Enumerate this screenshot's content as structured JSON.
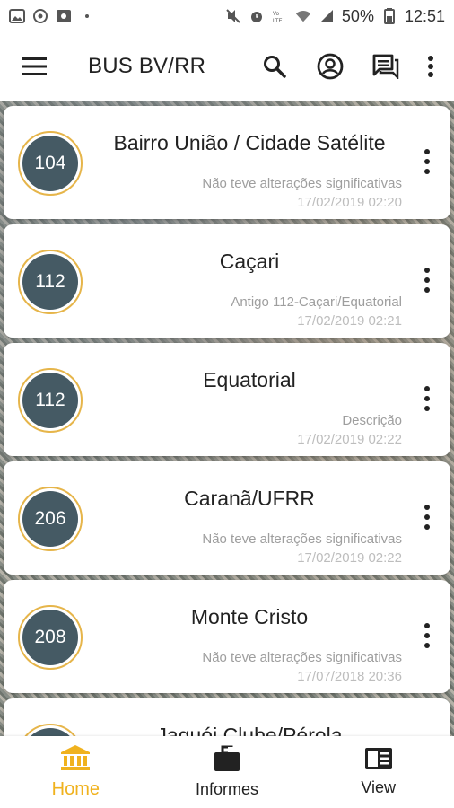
{
  "statusbar": {
    "battery": "50%",
    "time": "12:51"
  },
  "appbar": {
    "title": "BUS BV/RR",
    "icons": [
      "menu-icon",
      "search-icon",
      "account-icon",
      "messages-icon",
      "more-vert-icon"
    ]
  },
  "routes": [
    {
      "number": "104",
      "name": "Bairro União / Cidade Satélite",
      "description": "Não teve alterações significativas",
      "date": "17/02/2019 02:20"
    },
    {
      "number": "112",
      "name": "Caçari",
      "description": "Antigo 112-Caçari/Equatorial",
      "date": "17/02/2019 02:21"
    },
    {
      "number": "112",
      "name": "Equatorial",
      "description": "Descrição",
      "date": "17/02/2019 02:22"
    },
    {
      "number": "206",
      "name": "Caranã/UFRR",
      "description": "Não teve alterações significativas",
      "date": "17/02/2019 02:22"
    },
    {
      "number": "208",
      "name": "Monte Cristo",
      "description": "Não teve alterações significativas",
      "date": "17/07/2018 20:36"
    },
    {
      "number": "",
      "name": "Jaquói Clube/Pérola",
      "description": "",
      "date": ""
    }
  ],
  "nav": {
    "items": [
      {
        "label": "Home",
        "icon": "bank-icon",
        "active": true
      },
      {
        "label": "Informes",
        "icon": "briefcase-icon",
        "active": false
      },
      {
        "label": "View",
        "icon": "view-list-icon",
        "active": false
      }
    ],
    "active_color": "#f0b21e"
  },
  "colors": {
    "badge_fill": "#455a64",
    "badge_ring": "#e6b54a"
  }
}
